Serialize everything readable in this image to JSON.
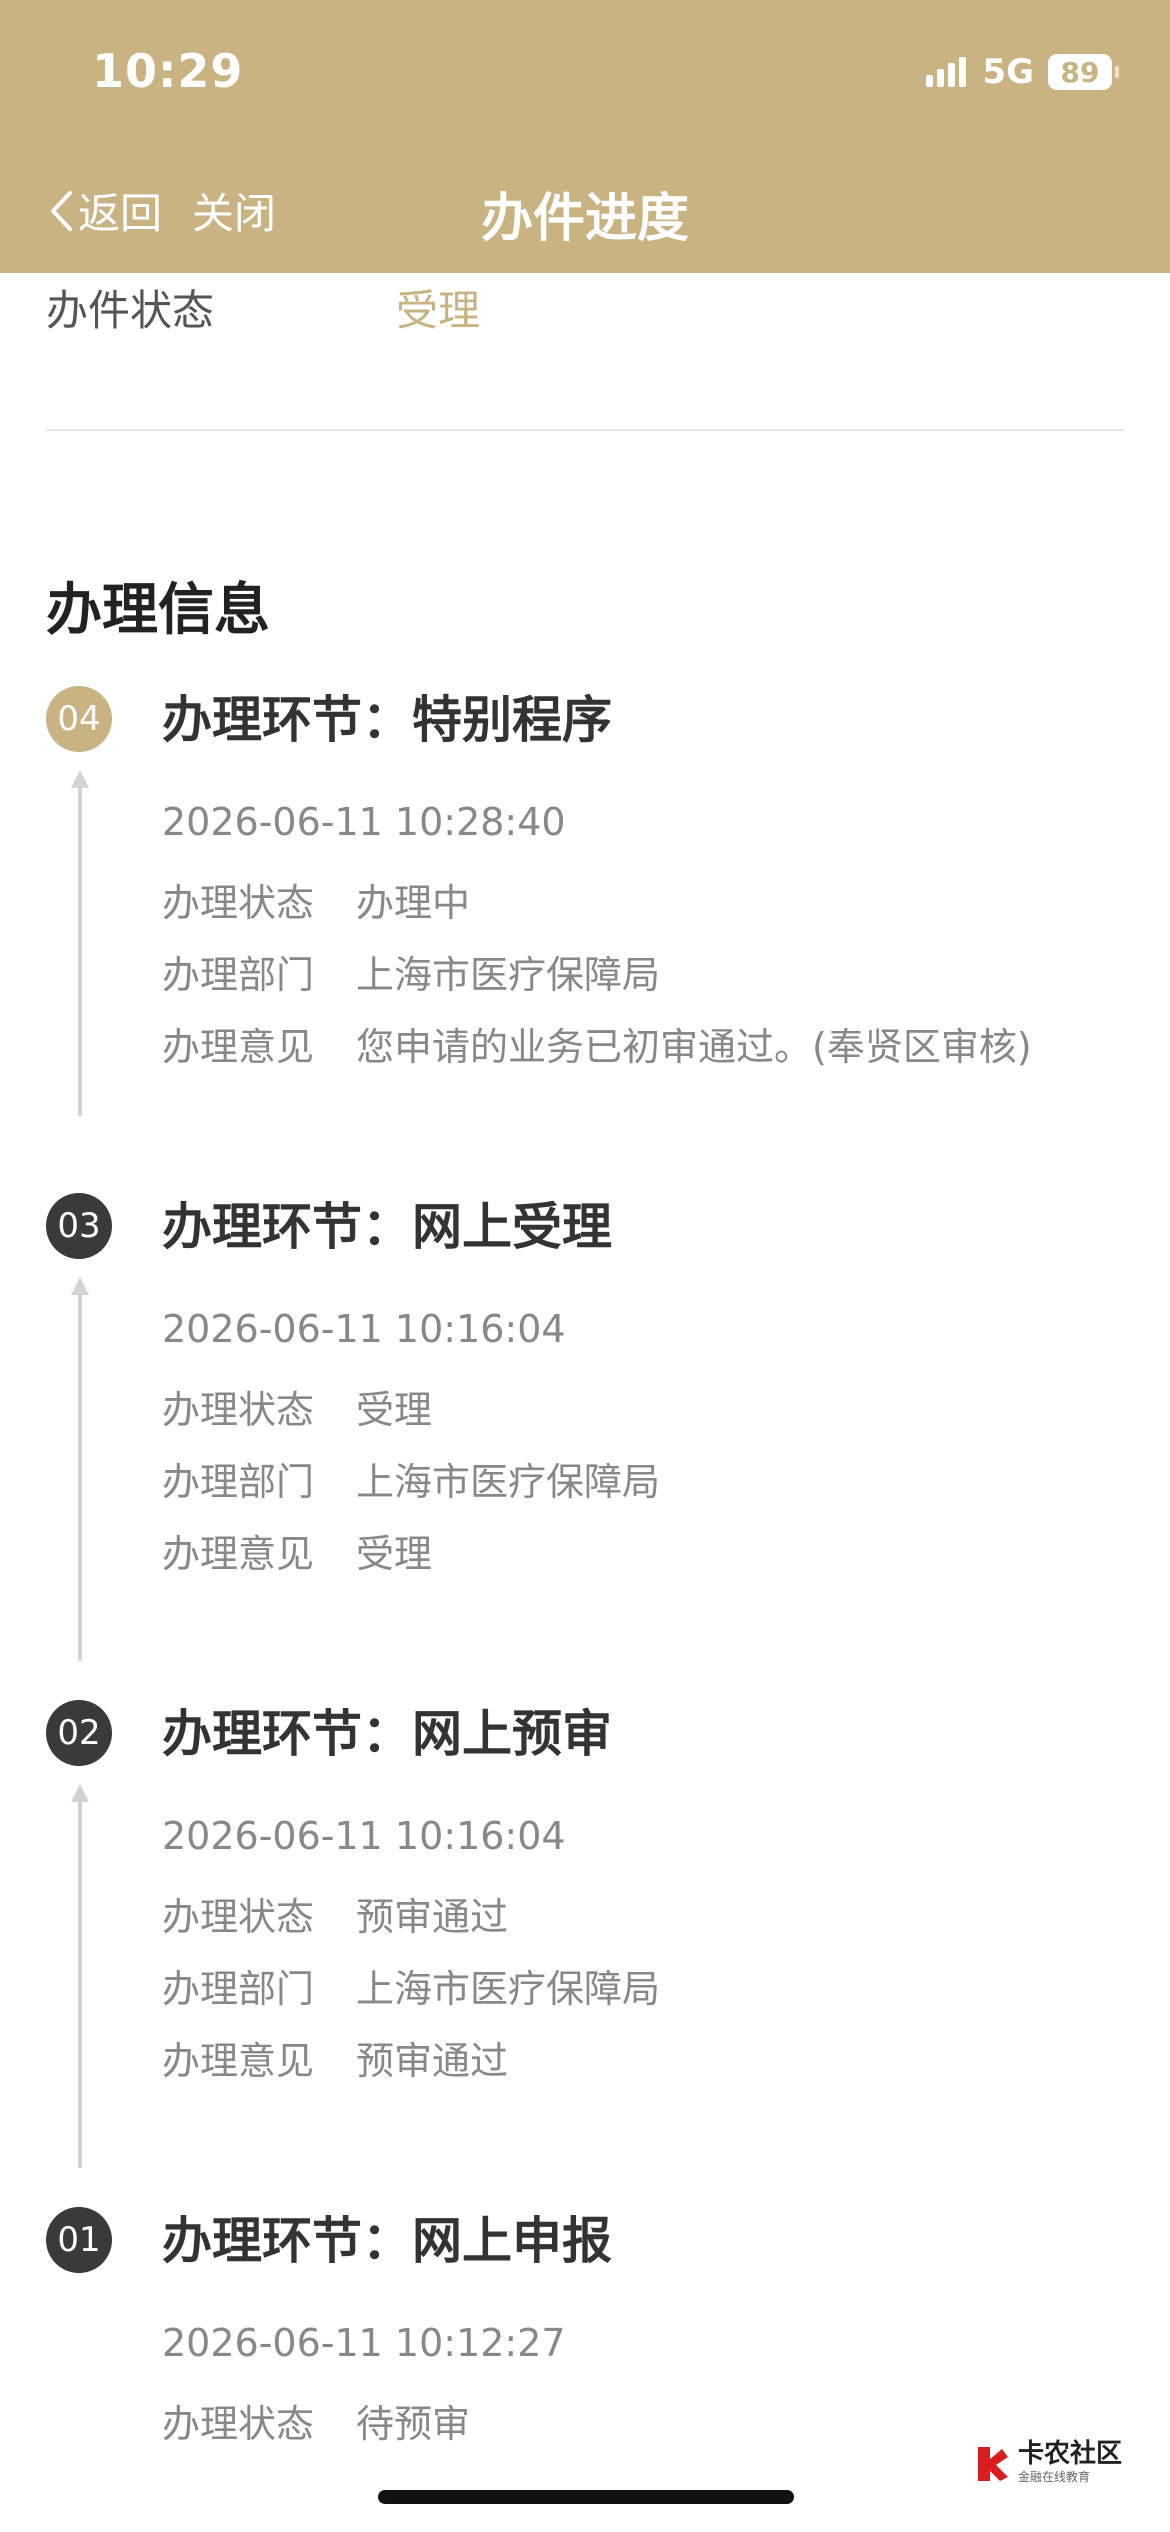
{
  "status_bar": {
    "time": "10:29",
    "network": "5G",
    "battery": "89"
  },
  "nav": {
    "back_label": "返回",
    "close_label": "关闭",
    "title": "办件进度"
  },
  "case_status": {
    "label": "办件状态",
    "value": "受理"
  },
  "section_title": "办理信息",
  "steps": [
    {
      "badge": "04",
      "title": "办理环节：特别程序",
      "time": "2026-06-11 10:28:40",
      "status_label": "办理状态",
      "status": "办理中",
      "dept_label": "办理部门",
      "dept": "上海市医疗保障局",
      "opinion_label": "办理意见",
      "opinion": "您申请的业务已初审通过。(奉贤区审核)"
    },
    {
      "badge": "03",
      "title": "办理环节：网上受理",
      "time": "2026-06-11 10:16:04",
      "status_label": "办理状态",
      "status": "受理",
      "dept_label": "办理部门",
      "dept": "上海市医疗保障局",
      "opinion_label": "办理意见",
      "opinion": "受理"
    },
    {
      "badge": "02",
      "title": "办理环节：网上预审",
      "time": "2026-06-11 10:16:04",
      "status_label": "办理状态",
      "status": "预审通过",
      "dept_label": "办理部门",
      "dept": "上海市医疗保障局",
      "opinion_label": "办理意见",
      "opinion": "预审通过"
    },
    {
      "badge": "01",
      "title": "办理环节：网上申报",
      "time": "2026-06-11 10:12:27",
      "status_label": "办理状态",
      "status": "待预审"
    }
  ],
  "watermark": {
    "main": "卡农社区",
    "sub": "金融在线教育"
  },
  "colors": {
    "accent": "#c9b383",
    "badge_active": "#c9b383",
    "badge_done": "#3a3a3a"
  }
}
